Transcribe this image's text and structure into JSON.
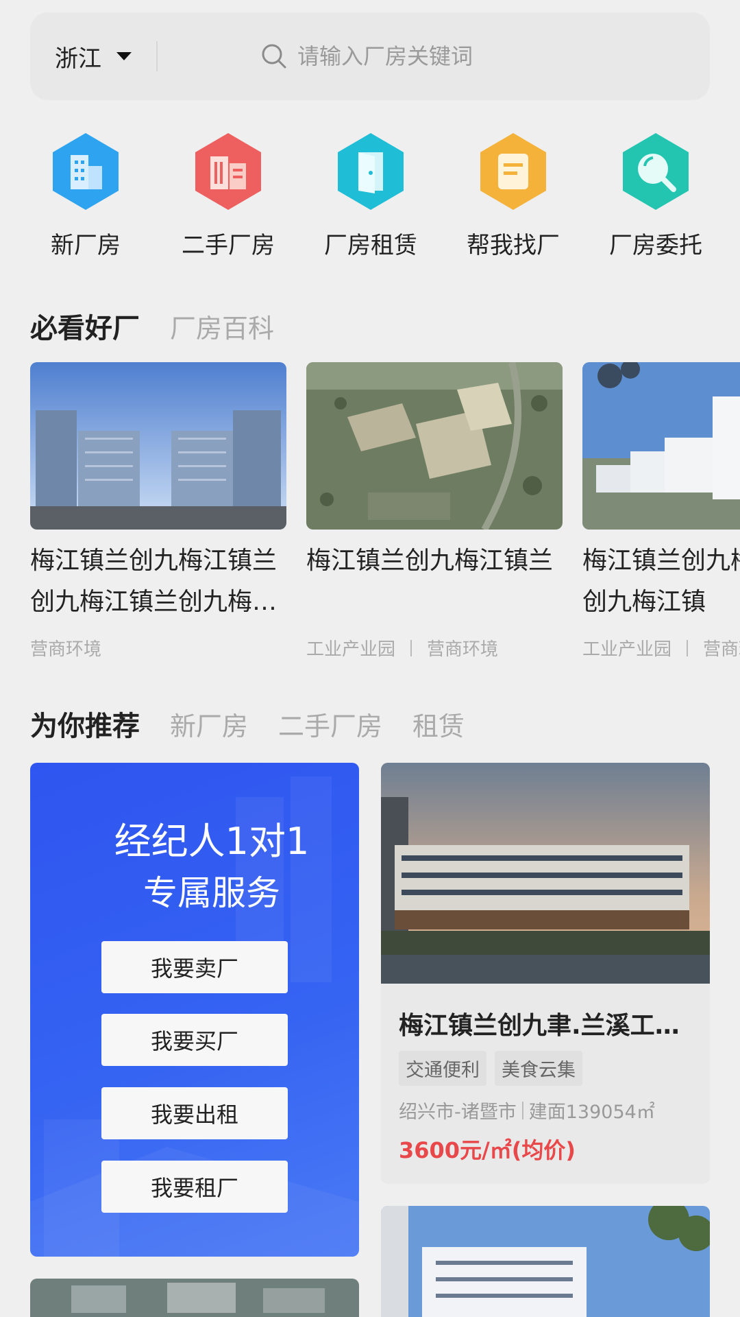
{
  "header": {
    "region": "浙江",
    "search_placeholder": "请输入厂房关键词"
  },
  "quick_entries": [
    {
      "label": "新厂房",
      "icon": "building-icon",
      "color": "#2ea3ef"
    },
    {
      "label": "二手厂房",
      "icon": "office-building-icon",
      "color": "#ee5f5f"
    },
    {
      "label": "厂房租赁",
      "icon": "door-icon",
      "color": "#1fbdd6"
    },
    {
      "label": "帮我找厂",
      "icon": "document-icon",
      "color": "#f4b23b"
    },
    {
      "label": "厂房委托",
      "icon": "magnifier-icon",
      "color": "#23c5b0"
    }
  ],
  "featured": {
    "tabs": [
      "必看好厂",
      "厂房百科"
    ],
    "cards": [
      {
        "title": "梅江镇兰创九梅江镇兰创九梅江镇兰创九梅江镇兰创九",
        "tags": [
          "营商环境"
        ]
      },
      {
        "title": "梅江镇兰创九梅江镇兰",
        "tags": [
          "工业产业园",
          "营商环境"
        ]
      },
      {
        "title": "梅江镇兰创九梅江镇兰创九梅江镇",
        "tags": [
          "工业产业园",
          "营商环境"
        ]
      }
    ]
  },
  "recommend": {
    "tabs": [
      "为你推荐",
      "新厂房",
      "二手厂房",
      "租赁"
    ],
    "promo": {
      "title": "经纪人1对1",
      "subtitle": "专属服务",
      "buttons": [
        "我要卖厂",
        "我要买厂",
        "我要出租",
        "我要租厂"
      ]
    },
    "listing": {
      "title": "梅江镇兰创九聿.兰溪工业园",
      "tags": [
        "交通便利",
        "美食云集"
      ],
      "location": "绍兴市-诸暨市",
      "area": "建面139054㎡",
      "price": "3600元/㎡(均价)"
    }
  },
  "colors": {
    "accent_blue": "#2f55f0",
    "price_red": "#e8484a"
  }
}
